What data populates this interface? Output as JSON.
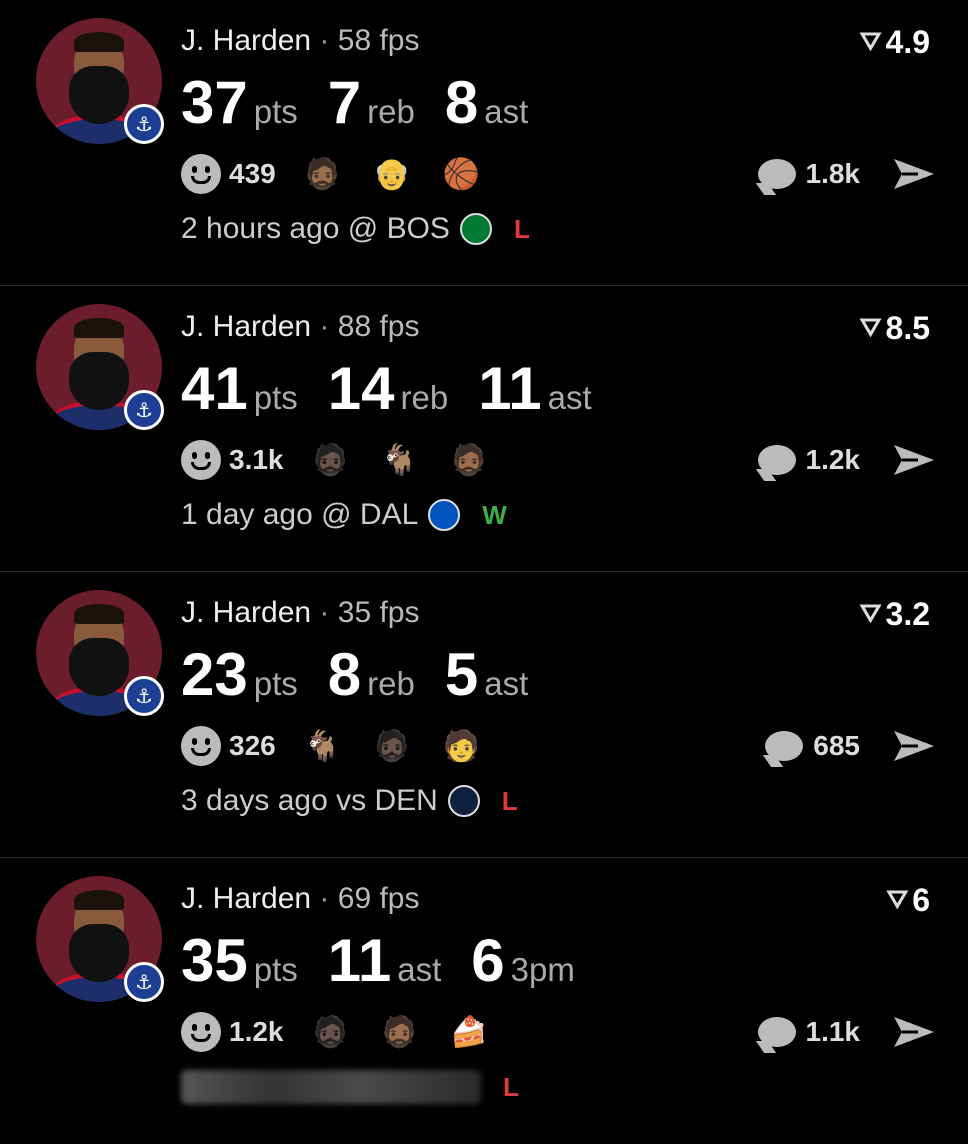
{
  "posts": [
    {
      "player": "J. Harden",
      "sep": "·",
      "fps": "58 fps",
      "score": "4.9",
      "stats": [
        {
          "value": "37",
          "unit": "pts"
        },
        {
          "value": "7",
          "unit": "reb"
        },
        {
          "value": "8",
          "unit": "ast"
        }
      ],
      "reactions": "439",
      "emojis": [
        "🧔🏾",
        "👴",
        "🏀"
      ],
      "comments": "1.8k",
      "time": "2 hours ago @ BOS",
      "team_color": "#007a33",
      "team_icon": "celtics-logo-icon",
      "result": "L",
      "result_color": "#e03a3e"
    },
    {
      "player": "J. Harden",
      "sep": "·",
      "fps": "88 fps",
      "score": "8.5",
      "stats": [
        {
          "value": "41",
          "unit": "pts"
        },
        {
          "value": "14",
          "unit": "reb"
        },
        {
          "value": "11",
          "unit": "ast"
        }
      ],
      "reactions": "3.1k",
      "emojis": [
        "🧔🏿",
        "🐐",
        "🧔🏾"
      ],
      "comments": "1.2k",
      "time": "1 day ago @ DAL",
      "team_color": "#0053bc",
      "team_icon": "mavericks-logo-icon",
      "result": "W",
      "result_color": "#3cb043"
    },
    {
      "player": "J. Harden",
      "sep": "·",
      "fps": "35 fps",
      "score": "3.2",
      "stats": [
        {
          "value": "23",
          "unit": "pts"
        },
        {
          "value": "8",
          "unit": "reb"
        },
        {
          "value": "5",
          "unit": "ast"
        }
      ],
      "reactions": "326",
      "emojis": [
        "🐐",
        "🧔🏿",
        "🧑"
      ],
      "comments": "685",
      "time": "3 days ago vs DEN",
      "team_color": "#0e2240",
      "team_icon": "nuggets-logo-icon",
      "result": "L",
      "result_color": "#e03a3e"
    },
    {
      "player": "J. Harden",
      "sep": "·",
      "fps": "69 fps",
      "score": "6",
      "stats": [
        {
          "value": "35",
          "unit": "pts"
        },
        {
          "value": "11",
          "unit": "ast"
        },
        {
          "value": "6",
          "unit": "3pm"
        }
      ],
      "reactions": "1.2k",
      "emojis": [
        "🧔🏿",
        "🧔🏾",
        "🍰"
      ],
      "comments": "1.1k",
      "time": "",
      "team_color": "#333333",
      "team_icon": "blurred-team-logo",
      "result": "L",
      "result_color": "#e03a3e"
    }
  ]
}
